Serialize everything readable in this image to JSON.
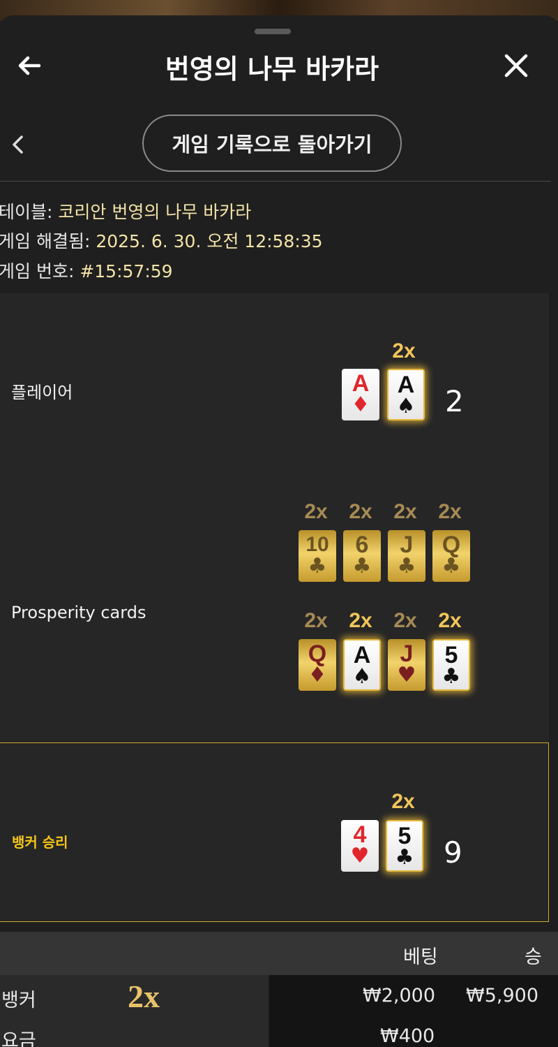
{
  "header": {
    "title": "번영의 나무 바카라",
    "back_icon": "arrow-left-icon",
    "close_icon": "close-icon"
  },
  "nav": {
    "back_button_label": "게임 기록으로 돌아가기"
  },
  "info": {
    "table_label": "테이블:",
    "table_value": "코리안 번영의 나무 바카라",
    "resolved_label": "게임 해결됨:",
    "resolved_value": "2025. 6. 30. 오전 12:58:35",
    "game_no_label": "게임 번호:",
    "game_no_value": "#15:57:59"
  },
  "player": {
    "label": "플레이어",
    "score": "2",
    "cards": [
      {
        "rank": "A",
        "suit": "♦",
        "color": "red",
        "multiplier": ""
      },
      {
        "rank": "A",
        "suit": "♠",
        "color": "black",
        "multiplier": "2x"
      }
    ]
  },
  "prosperity": {
    "label": "Prosperity cards",
    "row1": [
      {
        "rank": "10",
        "suit": "♣",
        "multiplier": "2x",
        "highlight": false
      },
      {
        "rank": "6",
        "suit": "♣",
        "multiplier": "2x",
        "highlight": false
      },
      {
        "rank": "J",
        "suit": "♣",
        "multiplier": "2x",
        "highlight": false
      },
      {
        "rank": "Q",
        "suit": "♣",
        "multiplier": "2x",
        "highlight": false
      }
    ],
    "row2": [
      {
        "rank": "Q",
        "suit": "♦",
        "color": "red",
        "multiplier": "2x",
        "highlight": false
      },
      {
        "rank": "A",
        "suit": "♠",
        "color": "black",
        "multiplier": "2x",
        "highlight": true
      },
      {
        "rank": "J",
        "suit": "♥",
        "color": "red",
        "multiplier": "2x",
        "highlight": false
      },
      {
        "rank": "5",
        "suit": "♣",
        "color": "black",
        "multiplier": "2x",
        "highlight": true
      }
    ]
  },
  "banker": {
    "label": "뱅커 승리",
    "score": "9",
    "cards": [
      {
        "rank": "4",
        "suit": "♥",
        "color": "red",
        "multiplier": ""
      },
      {
        "rank": "5",
        "suit": "♣",
        "color": "black",
        "multiplier": "2x"
      }
    ]
  },
  "bets": {
    "col_bet": "베팅",
    "col_win": "승",
    "rows": [
      {
        "name": "뱅커",
        "multiplier": "2x",
        "bet": "₩2,000",
        "win": "₩5,900"
      },
      {
        "name": "요금",
        "multiplier": "",
        "bet": "₩400",
        "win": ""
      }
    ]
  },
  "colors": {
    "accent_gold": "#f5c518",
    "card_red": "#e0262c",
    "glow": "#e5b93c"
  }
}
